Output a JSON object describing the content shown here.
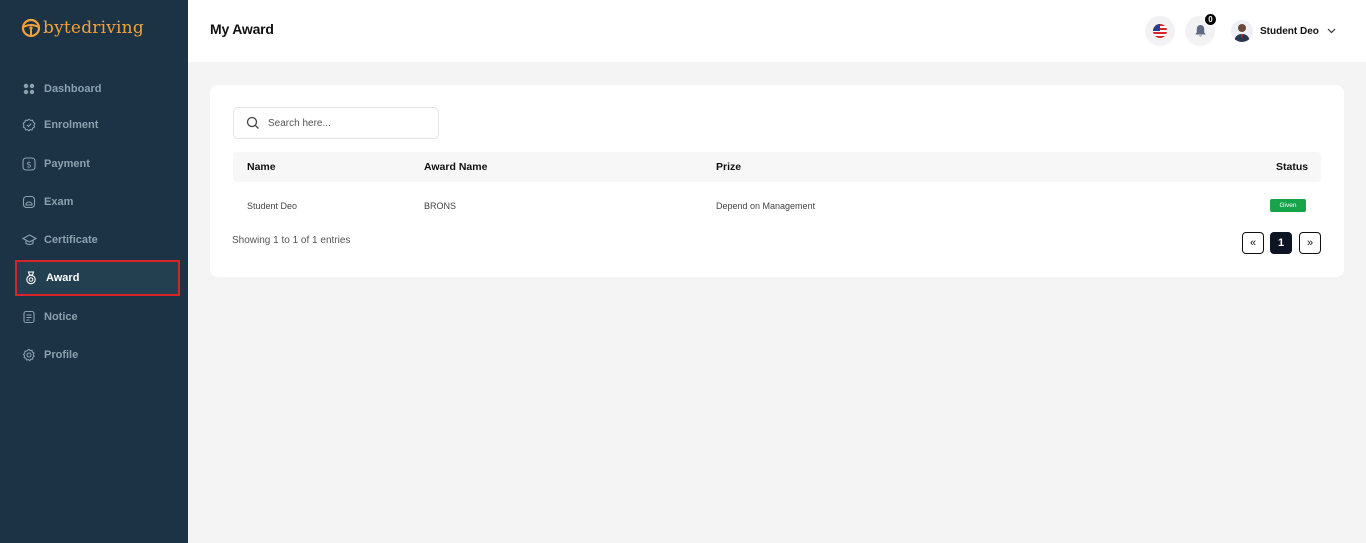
{
  "brand": {
    "name_part1": "byte",
    "name_part2": "driving",
    "color": "#f1a33a"
  },
  "sidebar": {
    "items": [
      {
        "label": "Dashboard",
        "icon": "grid-icon"
      },
      {
        "label": "Enrolment",
        "icon": "badge-check-icon"
      },
      {
        "label": "Payment",
        "icon": "dollar-icon"
      },
      {
        "label": "Exam",
        "icon": "exam-icon"
      },
      {
        "label": "Certificate",
        "icon": "graduation-cap-icon"
      },
      {
        "label": "Award",
        "icon": "award-icon",
        "active": true
      },
      {
        "label": "Notice",
        "icon": "notice-icon"
      },
      {
        "label": "Profile",
        "icon": "gear-icon"
      }
    ],
    "active_border_color": "#d9232a"
  },
  "header": {
    "title": "My Award",
    "language_icon": "us-flag-icon",
    "notifications": {
      "icon": "bell-icon",
      "count": "0"
    },
    "user": {
      "name": "Student Deo"
    }
  },
  "search": {
    "placeholder": "Search here..."
  },
  "table": {
    "columns": [
      "Name",
      "Award Name",
      "Prize",
      "Status"
    ],
    "rows": [
      {
        "name": "Student Deo",
        "award_name": "BRONS",
        "prize": "Depend on Management",
        "status": "Given"
      }
    ],
    "status_color": "#17a34a"
  },
  "footer": {
    "entries_text": "Showing 1 to 1 of 1 entries",
    "pagination": {
      "prev": "«",
      "current": "1",
      "next": "»"
    }
  }
}
